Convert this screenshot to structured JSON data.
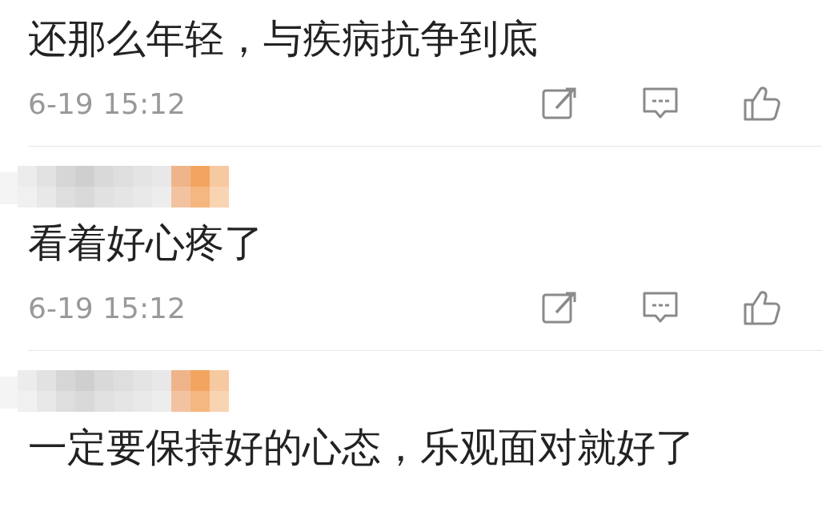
{
  "comments": [
    {
      "author_hidden": false,
      "text": "还那么年轻，与疾病抗争到底",
      "time": "6-19 15:12"
    },
    {
      "author_hidden": true,
      "text": "看着好心疼了",
      "time": "6-19 15:12"
    },
    {
      "author_hidden": true,
      "text": "一定要保持好的心态，乐观面对就好了"
    }
  ]
}
